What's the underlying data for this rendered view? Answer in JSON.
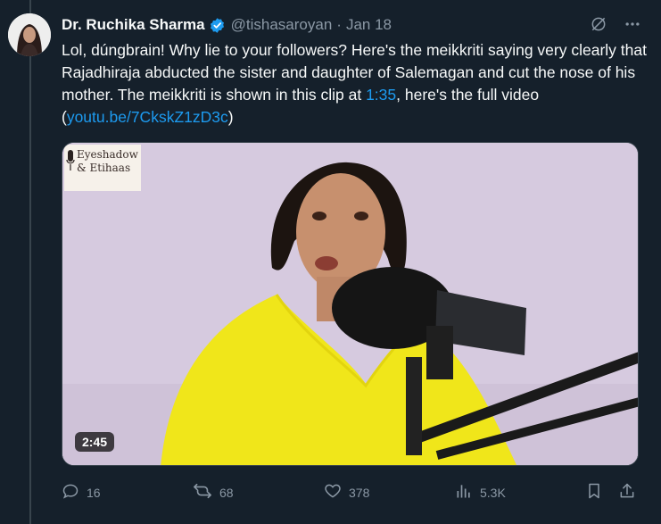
{
  "author": {
    "name": "Dr. Ruchika Sharma",
    "handle": "@tishasaroyan",
    "separator": "·",
    "date": "Jan 18"
  },
  "tweet": {
    "text_before_time": "Lol, dúngbrain! Why lie to your followers? Here's the meikkriti saying very clearly that Rajadhiraja abducted the sister and daughter of Salemagan and cut the nose of his mother. The meikkriti is shown in this clip at ",
    "time_link": "1:35",
    "text_mid": ", here's the full video (",
    "video_link": "youtu.be/7CkskZ1zD3c",
    "text_end": ")"
  },
  "media": {
    "watermark_line1": "Eyeshadow",
    "watermark_line2": "& Etihaas",
    "duration": "2:45"
  },
  "actions": {
    "replies": "16",
    "reposts": "68",
    "likes": "378",
    "views": "5.3K"
  },
  "colors": {
    "background": "#15202b",
    "link": "#1d9bf0",
    "muted": "#8b98a5",
    "verified": "#1d9bf0"
  },
  "icons": [
    "verified-badge-icon",
    "grok-icon",
    "more-icon",
    "reply-icon",
    "repost-icon",
    "like-icon",
    "views-icon",
    "bookmark-icon",
    "share-icon",
    "microphone-icon"
  ]
}
